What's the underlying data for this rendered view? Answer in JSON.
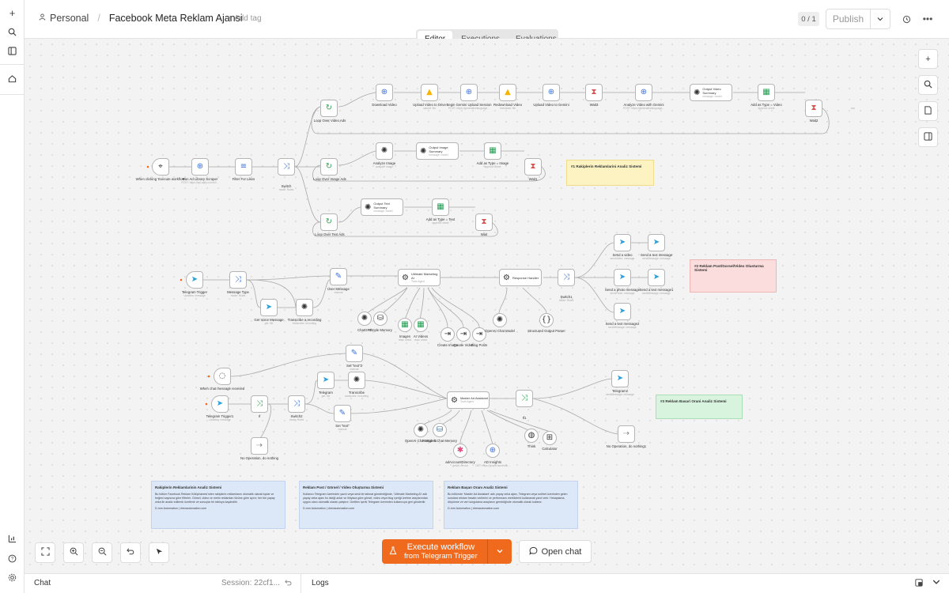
{
  "header": {
    "workspace": "Personal",
    "workflow_name": "Facebook Meta Reklam Ajansi",
    "add_tag": "+ Add tag",
    "version_counter": "0 / 1",
    "publish_label": "Publish"
  },
  "tabs": [
    "Editor",
    "Executions",
    "Evaluations"
  ],
  "nodes": {
    "when_clicking": {
      "label": "When clicking 'Execute workflow'"
    },
    "run_ad_library": {
      "label": "Run Ad Library Scraper",
      "sub": "POST: https://api.apify.com/v2/..."
    },
    "filter_likes": {
      "label": "Filter For Likes"
    },
    "switch": {
      "label": "Switch",
      "sub": "mode: Rules"
    },
    "loop_video": {
      "label": "Loop Over Video Ads"
    },
    "download_video": {
      "label": "Download Video"
    },
    "upload_drive": {
      "label": "Upload Video to Drive",
      "sub": "upload: file"
    },
    "begin_gemini": {
      "label": "Begin Gemini Upload Session",
      "sub": "POST: https://generativelanguage..."
    },
    "redownload": {
      "label": "Redownload Video",
      "sub": "download: file"
    },
    "upload_gemini": {
      "label": "Upload Video to Gemini"
    },
    "wait3": {
      "label": "Wait3"
    },
    "analyze_gemini": {
      "label": "Analyze Video with Gemini",
      "sub": "POST: https://generativelanguage..."
    },
    "output_video": {
      "label": "Output Video Summary",
      "sub": "message: model"
    },
    "add_video": {
      "label": "Add as Type = Video",
      "sub": "append: sheet"
    },
    "wait2": {
      "label": "Wait2"
    },
    "loop_image": {
      "label": "Loop Over Image Ads"
    },
    "analyze_image": {
      "label": "Analyze Image",
      "sub": "analyze: image"
    },
    "output_image": {
      "label": "Output Image Summary",
      "sub": "message: model"
    },
    "add_image": {
      "label": "Add as Type = Image",
      "sub": "append: sheet"
    },
    "wait1": {
      "label": "Wait1"
    },
    "loop_text": {
      "label": "Loop Over Text Ads"
    },
    "output_text": {
      "label": "Output Text Summary",
      "sub": "message: model"
    },
    "add_text": {
      "label": "Add as Type = Text",
      "sub": "append: sheet"
    },
    "wait": {
      "label": "Wait"
    },
    "telegram_trigger": {
      "label": "Telegram Trigger",
      "sub": "Updates: message"
    },
    "message_type": {
      "label": "Message Type",
      "sub": "mode: Rules"
    },
    "get_voice": {
      "label": "Get Voice Message",
      "sub": "get: file"
    },
    "transcribe": {
      "label": "Transcribe a recording",
      "sub": "transcribe: recording"
    },
    "user_message": {
      "label": "User Message",
      "sub": "manual"
    },
    "ultimate_ai": {
      "label": "Ultimate Marketing AI",
      "sub": "Tools Agent"
    },
    "chatgpt": {
      "label": "ChatGPT"
    },
    "simple_memory": {
      "label": "Simple Memory"
    },
    "images": {
      "label": "Images",
      "sub": "read: sheet"
    },
    "ai_videos": {
      "label": "AI Videos",
      "sub": "read: sheet"
    },
    "create_image": {
      "label": "Create Image"
    },
    "create_video": {
      "label": "Create Video"
    },
    "blog_posts": {
      "label": "Blog Posts"
    },
    "response_handler": {
      "label": "Response Handler"
    },
    "openai_chat": {
      "label": "OpenAI Chat Model"
    },
    "structured_parser": {
      "label": "Structured Output Parser"
    },
    "switch1": {
      "label": "Switch1",
      "sub": "mode: Rules"
    },
    "send_video": {
      "label": "Send a video",
      "sub": "sendVideo: message"
    },
    "send_text": {
      "label": "Send a text message",
      "sub": "sendMessage: message"
    },
    "send_photo": {
      "label": "Send a photo message",
      "sub": "sendPhoto: message"
    },
    "send_text1": {
      "label": "Send a text message1",
      "sub": "sendMessage: message"
    },
    "send_text2": {
      "label": "Send a text message2",
      "sub": "sendMessage: message"
    },
    "chat_received": {
      "label": "When chat message received"
    },
    "telegram_trigger1": {
      "label": "Telegram Trigger1",
      "sub": "Updates: message"
    },
    "if": {
      "label": "If"
    },
    "switch2": {
      "label": "Switch2",
      "sub": "mode: Rules"
    },
    "set_text2": {
      "label": "Set \"text\"2",
      "sub": "manual"
    },
    "telegram": {
      "label": "Telegram",
      "sub": "get: file"
    },
    "transcribe2": {
      "label": "Transcribe",
      "sub": "transcribe: recording"
    },
    "set_text": {
      "label": "Set \"text\"",
      "sub": "manual"
    },
    "noop": {
      "label": "No Operation, do nothing"
    },
    "master_ad": {
      "label": "Master Ad Assistant",
      "sub": "Tools Agent"
    },
    "openai_chat1": {
      "label": "OpenAI Chat Model1"
    },
    "postgres": {
      "label": "Postgres Chat Memory"
    },
    "ad_account": {
      "label": "adAccountDirectory",
      "sub": "getAll: record"
    },
    "ad_insights": {
      "label": "AD Insights",
      "sub": "GET: https://graph.facebook..."
    },
    "if1": {
      "label": "If1"
    },
    "think": {
      "label": "Think"
    },
    "calculator": {
      "label": "Calculator"
    },
    "telegram2": {
      "label": "Telegram2",
      "sub": "sendMessage: message"
    },
    "noop1": {
      "label": "No Operation, do nothing1"
    }
  },
  "notes": {
    "n1": "#1 Rakiplerin Reklamlarini Analiz Sistemi",
    "n2": "#2 Reklam Post/Gorsel/Video Olusturma Sistemi",
    "n3": "#3 Reklam Basari Orani Analiz Sistemi"
  },
  "descriptions": [
    {
      "title": "Rakiplerin Reklamlarinin Analiz Sistemi",
      "body": "Bu bölüm Facebook Reklam Kütüphanesi'nden rakiplerin reklamlarını otomatik olarak toplar ve beğeni sayısına göre filtreler. Görsel, video ve metin reklamları türüne göre ayırır; her biri yapay zeka ile analiz edilerek özetlenir ve sonuçlar bir tabloya kaydedilir.",
      "footer": "D-mm Automation | dmmautomation.com"
    },
    {
      "title": "Reklam Post / Görsel / Video Oluşturma Sistemi",
      "body": "Kullanıcı Telegram üzerinden yazılı veya sesli bir talimat gönderdiğinde, 'Ultimate Marketing AI' adlı yapay zeka ajanı bu isteği anlar ve ihtiyaca göre görsel, video veya blog içeriği üretme araçlarından uygun olanı otomatik olarak çalıştırır. Üretilen içerik Telegram üzerinden kullanıcıya geri gönderilir.",
      "footer": "D-mm Automation | dmmautomation.com"
    },
    {
      "title": "Reklam Başarı Oranı Analiz Sistemi",
      "body": "Bu bölümde 'Master Ad Assistant' adlı yapay zeka ajanı, Telegram veya sohbet üzerinden gelen sorulara reklam hesabı verilerini ve performans metriklerini kullanarak yanıt verir. Hesaplama, düşünme ve veri sorgulama araçlarını gerektiğinde otomatik olarak kullanır.",
      "footer": "D-mm Automation | dmmautomation.com"
    }
  ],
  "bottom": {
    "execute_label": "Execute workflow",
    "execute_sub": "from Telegram Trigger",
    "open_chat": "Open chat",
    "chat_tab": "Chat",
    "session": "Session: 22cf1...",
    "logs": "Logs"
  },
  "colors": {
    "accent": "#f06a1e",
    "note_yellow": "#fdf3c2",
    "note_red": "#fbdddd",
    "note_green": "#d8f3de",
    "desc_blue": "#dce7f8"
  },
  "icons": [
    "plus-icon",
    "search-icon",
    "panel-icon",
    "home-icon",
    "chart-icon",
    "help-icon",
    "settings-icon",
    "history-icon",
    "more-icon",
    "fit-view-icon",
    "zoom-in-icon",
    "zoom-out-icon",
    "undo-icon",
    "tidy-icon",
    "flask-icon",
    "chat-bubble-icon",
    "sticky-note-icon",
    "sidebar-icon"
  ]
}
